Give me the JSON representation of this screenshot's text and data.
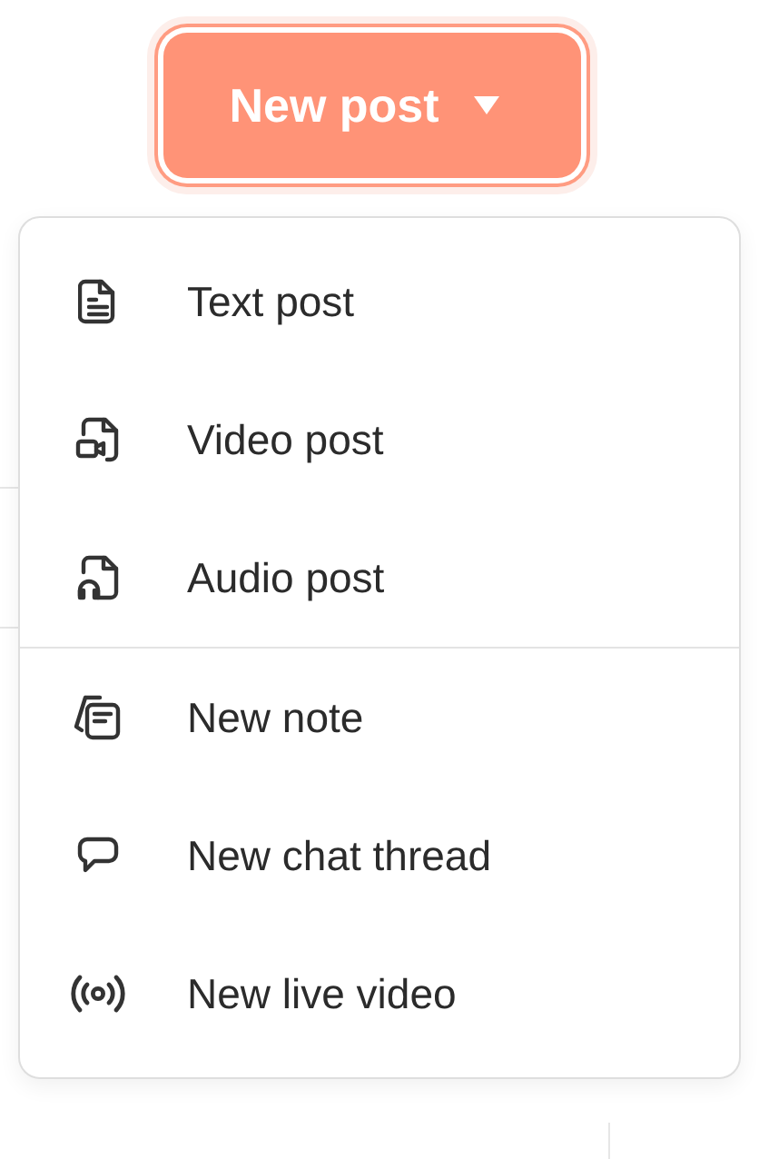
{
  "button": {
    "label": "New post"
  },
  "menu": {
    "groups": [
      {
        "items": [
          {
            "label": "Text post",
            "kind": "text"
          },
          {
            "label": "Video post",
            "kind": "video"
          },
          {
            "label": "Audio post",
            "kind": "audio"
          }
        ]
      },
      {
        "items": [
          {
            "label": "New note",
            "kind": "note"
          },
          {
            "label": "New chat thread",
            "kind": "chat"
          },
          {
            "label": "New live video",
            "kind": "live"
          }
        ]
      }
    ]
  }
}
